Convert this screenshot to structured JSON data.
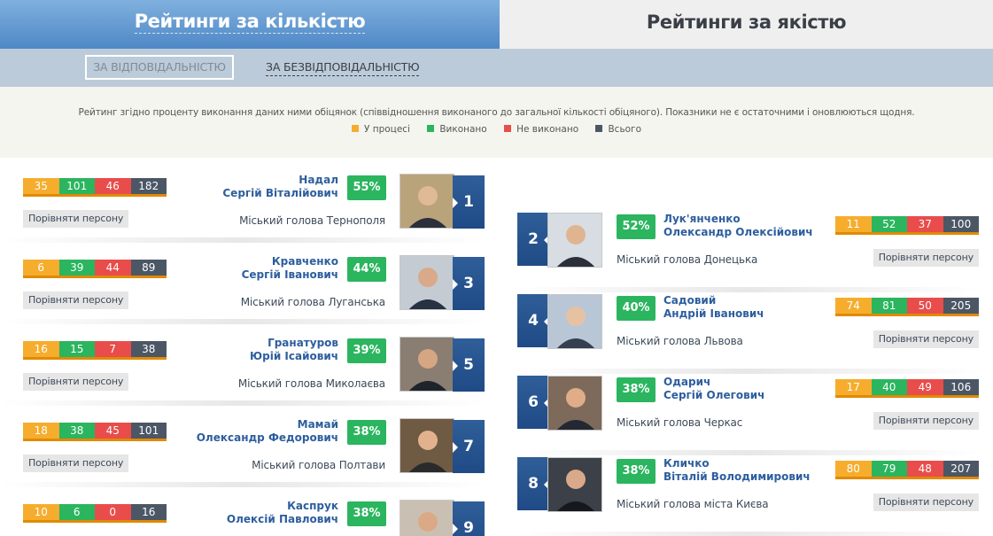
{
  "tabs": {
    "quantity": "Рейтинги за кількістю",
    "quality": "Рейтинги за якістю"
  },
  "subtabs": {
    "responsibility": "ЗА ВІДПОВІДАЛЬНІСТЮ",
    "irresponsibility": "ЗА БЕЗВІДПОВІДАЛЬНІСТЮ"
  },
  "info": {
    "text": "Рейтинг згідно проценту виконання даних ними обіцянок (співвідношення виконаного до загальної кількості обіцяного). Показники не є остаточними і оновлюються щодня.",
    "legend": [
      {
        "label": "У процесі",
        "color": "#f6ad2d"
      },
      {
        "label": "Виконано",
        "color": "#2bb55f"
      },
      {
        "label": "Не виконано",
        "color": "#e84d4b"
      },
      {
        "label": "Всього",
        "color": "#4c5766"
      }
    ]
  },
  "compare_label": "Порівняти персону",
  "people": [
    {
      "rank": "1",
      "surname": "Надал",
      "given": "Сергій Віталійович",
      "percent": "55%",
      "position": "Міський голова Тернополя",
      "in_progress": "35",
      "done": "101",
      "failed": "46",
      "total": "182",
      "photo": "photo-icon"
    },
    {
      "rank": "2",
      "surname": "Лук'янченко",
      "given": "Олександр Олексійович",
      "percent": "52%",
      "position": "Міський голова Донецька",
      "in_progress": "11",
      "done": "52",
      "failed": "37",
      "total": "100",
      "photo": "photo-icon"
    },
    {
      "rank": "3",
      "surname": "Кравченко",
      "given": "Сергій Іванович",
      "percent": "44%",
      "position": "Міський голова Луганська",
      "in_progress": "6",
      "done": "39",
      "failed": "44",
      "total": "89",
      "photo": "photo-icon"
    },
    {
      "rank": "4",
      "surname": "Садовий",
      "given": "Андрій Іванович",
      "percent": "40%",
      "position": "Міський голова Львова",
      "in_progress": "74",
      "done": "81",
      "failed": "50",
      "total": "205",
      "photo": "photo-icon"
    },
    {
      "rank": "5",
      "surname": "Гранатуров",
      "given": "Юрій Ісайович",
      "percent": "39%",
      "position": "Міський голова Миколаєва",
      "in_progress": "16",
      "done": "15",
      "failed": "7",
      "total": "38",
      "photo": "photo-icon"
    },
    {
      "rank": "6",
      "surname": "Одарич",
      "given": "Сергій Олегович",
      "percent": "38%",
      "position": "Міський голова Черкас",
      "in_progress": "17",
      "done": "40",
      "failed": "49",
      "total": "106",
      "photo": "photo-icon"
    },
    {
      "rank": "7",
      "surname": "Мамай",
      "given": "Олександр Федорович",
      "percent": "38%",
      "position": "Міський голова Полтави",
      "in_progress": "18",
      "done": "38",
      "failed": "45",
      "total": "101",
      "photo": "photo-icon"
    },
    {
      "rank": "8",
      "surname": "Кличко",
      "given": "Віталій Володимирович",
      "percent": "38%",
      "position": "Міський голова міста Києва",
      "in_progress": "80",
      "done": "79",
      "failed": "48",
      "total": "207",
      "photo": "photo-icon"
    },
    {
      "rank": "9",
      "surname": "Каспрук",
      "given": "Олексій Павлович",
      "percent": "38%",
      "position": "",
      "in_progress": "10",
      "done": "6",
      "failed": "0",
      "total": "16",
      "photo": "photo-icon"
    }
  ]
}
